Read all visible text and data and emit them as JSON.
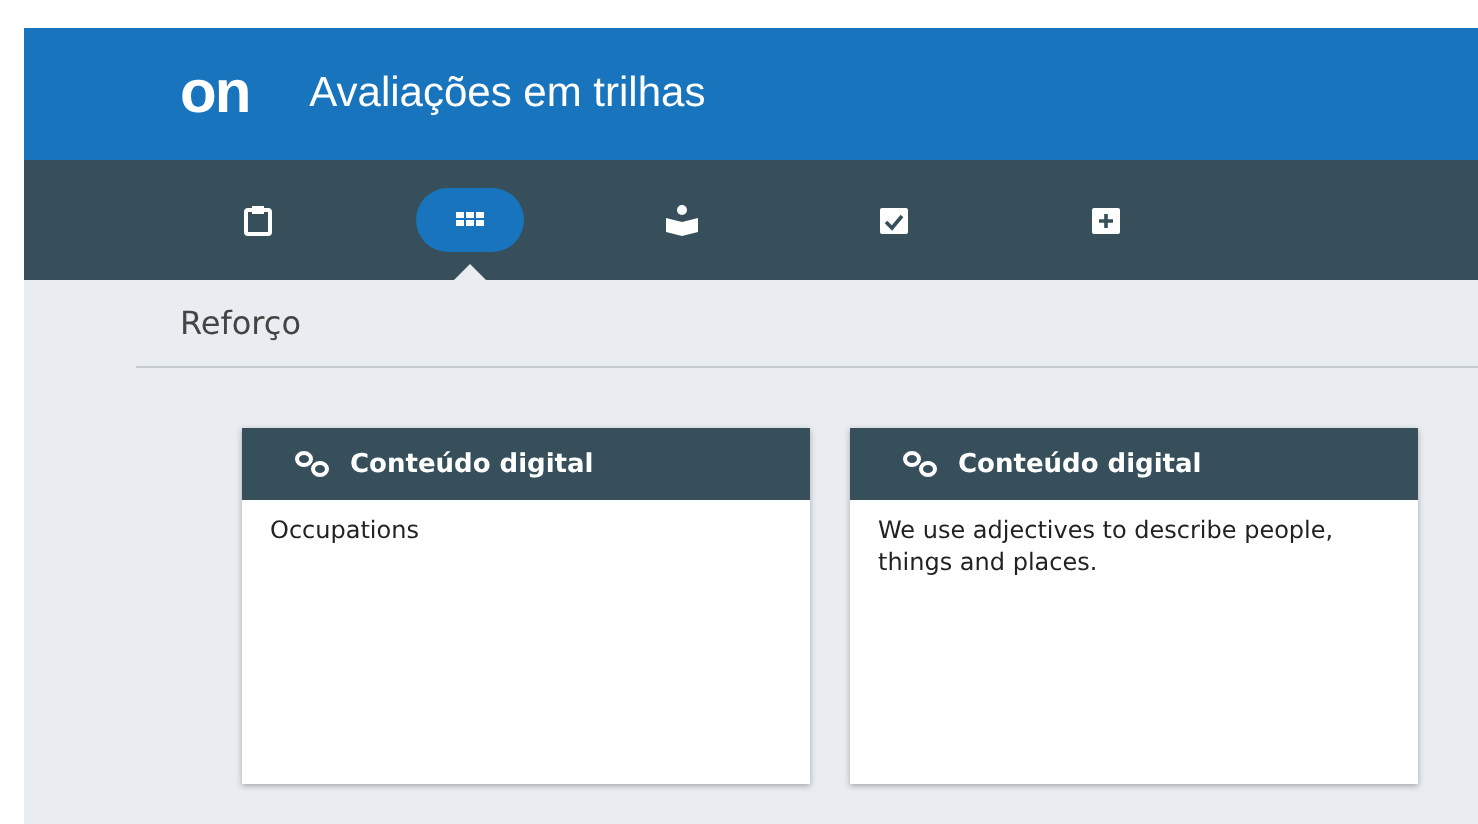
{
  "header": {
    "logo": "on",
    "title": "Avaliações em trilhas"
  },
  "tabs": [
    {
      "selected": false
    },
    {
      "selected": true
    },
    {
      "selected": false
    },
    {
      "selected": false
    },
    {
      "selected": false
    }
  ],
  "section": {
    "title": "Reforço"
  },
  "cards": [
    {
      "heading": "Conteúdo digital",
      "text": "Occupations"
    },
    {
      "heading": "Conteúdo digital",
      "text": "We use adjectives to describe people, things and places."
    }
  ]
}
